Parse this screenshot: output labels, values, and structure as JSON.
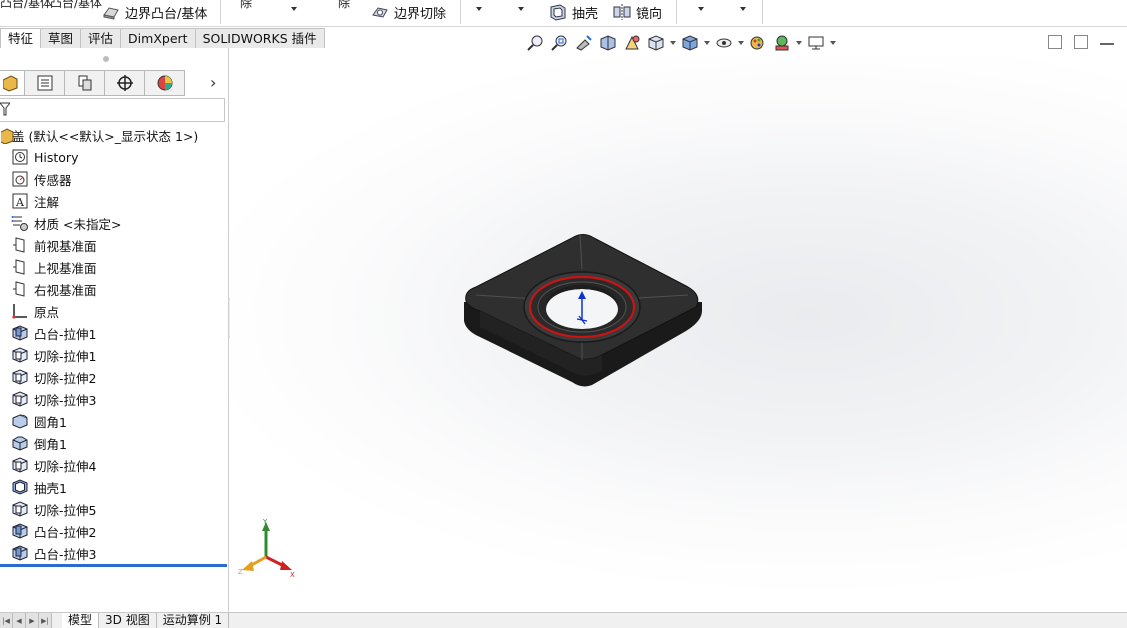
{
  "command_bar": {
    "cut_left_label": "凸台/基体",
    "cut_left_label2": "凸台/基体",
    "boundary_boss_label": "边界凸台/基体",
    "cut_mid_label1": "除",
    "cut_mid_label2": "除",
    "boundary_cut_label": "边界切除",
    "shell_label": "抽壳",
    "mirror_label": "镜向"
  },
  "tabs": [
    {
      "label": "特征",
      "active": true
    },
    {
      "label": "草图",
      "active": false
    },
    {
      "label": "评估",
      "active": false
    },
    {
      "label": "DimXpert",
      "active": false
    },
    {
      "label": "SOLIDWORKS 插件",
      "active": false
    }
  ],
  "view_toolbar": {
    "icons": [
      "zoom-to-fit-icon",
      "zoom-to-area-icon",
      "previous-view-icon",
      "section-view-icon",
      "dynamic-annotation-icon",
      "view-orientation-icon",
      "display-style-icon",
      "hide-show-items-icon",
      "edit-appearance-icon",
      "apply-scene-icon",
      "view-settings-icon"
    ]
  },
  "feature_tree": {
    "root": "盖 (默认<<默认>_显示状态 1>)",
    "items": [
      {
        "label": "History",
        "icon": "history-icon"
      },
      {
        "label": "传感器",
        "icon": "sensor-icon"
      },
      {
        "label": "注解",
        "icon": "annotation-icon"
      },
      {
        "label": "材质 <未指定>",
        "icon": "material-icon"
      },
      {
        "label": "前视基准面",
        "icon": "plane-icon"
      },
      {
        "label": "上视基准面",
        "icon": "plane-icon"
      },
      {
        "label": "右视基准面",
        "icon": "plane-icon"
      },
      {
        "label": "原点",
        "icon": "origin-icon"
      },
      {
        "label": "凸台-拉伸1",
        "icon": "boss-extrude-icon"
      },
      {
        "label": "切除-拉伸1",
        "icon": "cut-extrude-icon"
      },
      {
        "label": "切除-拉伸2",
        "icon": "cut-extrude-icon"
      },
      {
        "label": "切除-拉伸3",
        "icon": "cut-extrude-icon"
      },
      {
        "label": "圆角1",
        "icon": "fillet-icon"
      },
      {
        "label": "倒角1",
        "icon": "chamfer-icon"
      },
      {
        "label": "切除-拉伸4",
        "icon": "cut-extrude-icon"
      },
      {
        "label": "抽壳1",
        "icon": "shell-icon"
      },
      {
        "label": "切除-拉伸5",
        "icon": "cut-extrude-icon"
      },
      {
        "label": "凸台-拉伸2",
        "icon": "boss-extrude-icon"
      },
      {
        "label": "凸台-拉伸3",
        "icon": "boss-extrude-icon"
      }
    ]
  },
  "triad": {
    "x": "X",
    "y": "Y",
    "z": "Z"
  },
  "bottom_tabs": [
    {
      "label": "模型",
      "active": true
    },
    {
      "label": "3D 视图",
      "active": false
    },
    {
      "label": "运动算例 1",
      "active": false
    }
  ],
  "colors": {
    "accent": "#2b6ad1",
    "model": "#2a2a2a",
    "edge_highlight": "#d01818"
  }
}
